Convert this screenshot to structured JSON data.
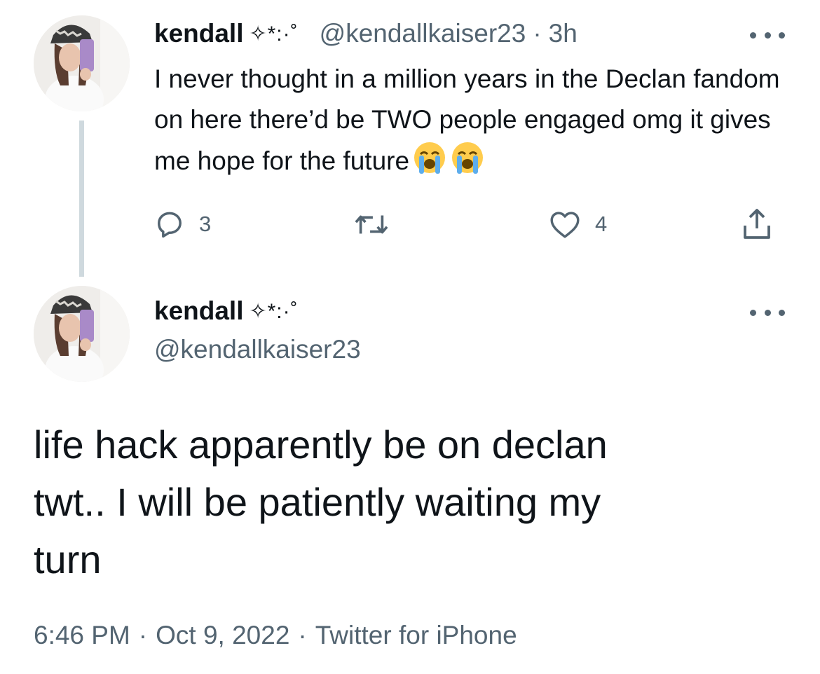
{
  "parent_tweet": {
    "display_name": "kendall",
    "name_decoration": "✧*:·˚",
    "handle": "@kendallkaiser23",
    "separator": "·",
    "relative_time": "3h",
    "text": "I never thought in a million years in the Declan fandom on here there’d be TWO people engaged omg it gives me hope for the future",
    "emoji": [
      "loudly-crying-face",
      "loudly-crying-face"
    ],
    "reply_count": "3",
    "retweet_count": "",
    "like_count": "4"
  },
  "main_tweet": {
    "display_name": "kendall",
    "name_decoration": "✧*:·˚",
    "handle": "@kendallkaiser23",
    "text_lines": [
      "life hack apparently be on declan",
      "twt.. I will be patiently waiting my",
      "turn"
    ],
    "time": "6:46 PM",
    "separator": "·",
    "date": "Oct 9, 2022",
    "source": "Twitter for iPhone"
  },
  "colors": {
    "text": "#0f1419",
    "secondary": "#536471",
    "thread_line": "#cfd9de",
    "background": "#ffffff"
  }
}
